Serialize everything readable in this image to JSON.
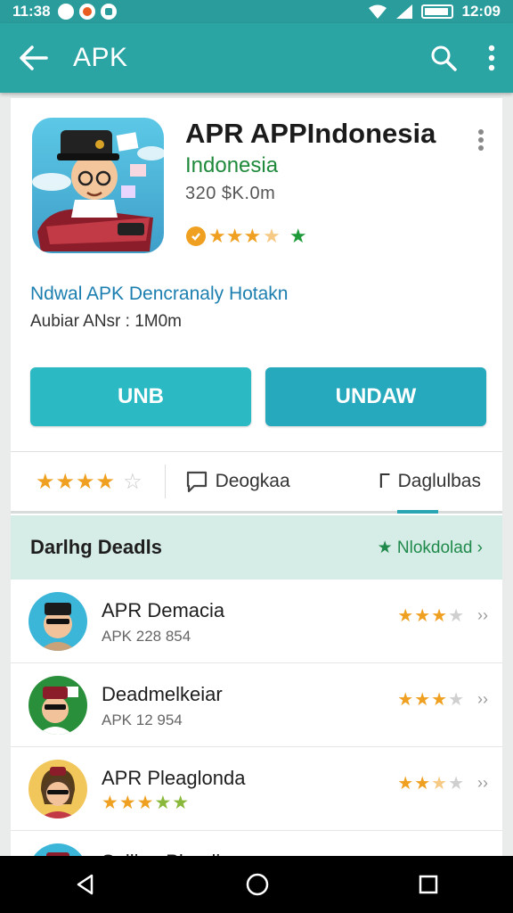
{
  "status_bar": {
    "time": "11:38",
    "right_time": "12:09"
  },
  "app_bar": {
    "title": "APK"
  },
  "app": {
    "title": "APR APPIndonesia",
    "subtitle": "Indonesia",
    "meta": "320 $K.0m",
    "description": "Ndwal APK Dencranaly Hotakn",
    "size_text": "Aubiar ANsr : 1M0m"
  },
  "buttons": {
    "primary": "UNB",
    "secondary": "UNDAW"
  },
  "tabs": {
    "reviews": "Deogkaa",
    "other": "Daglulbas"
  },
  "section": {
    "title": "Darlhg Deadls",
    "more": "Nlokdolad ›"
  },
  "list": [
    {
      "name": "APR Demacia",
      "sub": "APK 228 854",
      "rating": 3
    },
    {
      "name": "Deadmelkeiar",
      "sub": "APK 12 954",
      "rating": 3
    },
    {
      "name": "APR Pleaglonda",
      "sub": "",
      "rating": 2.5
    },
    {
      "name": "Sollion Phenliar",
      "sub": "",
      "rating": 0
    }
  ],
  "colors": {
    "accent": "#2ba4a4",
    "button": "#2bbac3",
    "star": "#f0a020",
    "section_bg": "#d6ece6"
  }
}
